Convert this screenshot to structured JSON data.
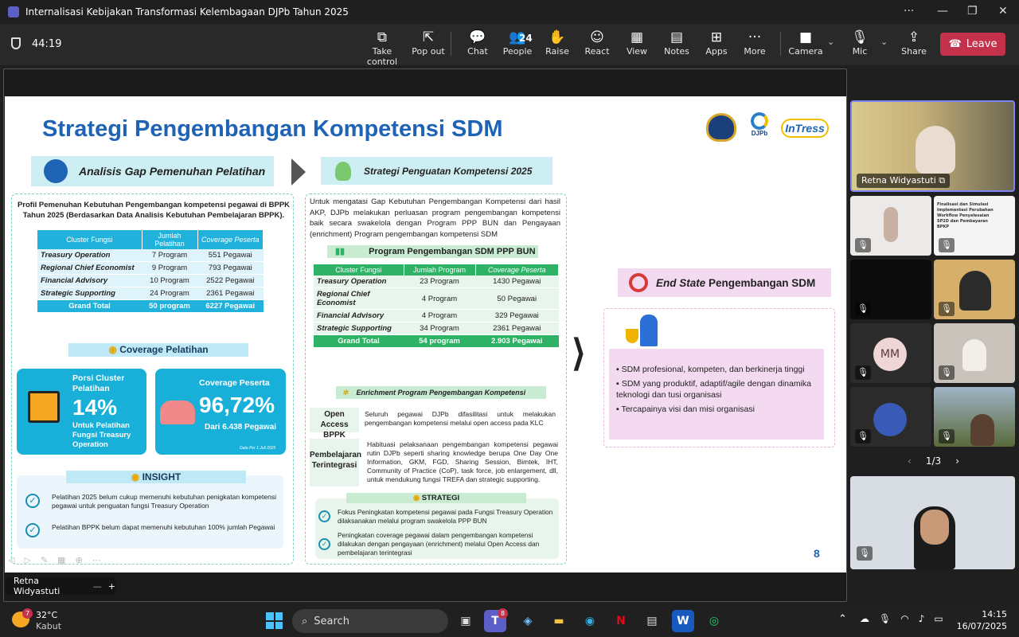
{
  "window": {
    "title": "Internalisasi Kebijakan Transformasi Kelembagaan DJPb Tahun 2025",
    "more": "···",
    "minimize": "—",
    "maximize": "❐",
    "close": "✕"
  },
  "meeting": {
    "timer": "44:19",
    "people_count": "24"
  },
  "toolbar": [
    {
      "label": "Take control",
      "icon": "⧉"
    },
    {
      "label": "Pop out",
      "icon": "⇱"
    },
    {
      "label": "Chat",
      "icon": "💬"
    },
    {
      "label": "People",
      "icon": "👥"
    },
    {
      "label": "Raise",
      "icon": "✋"
    },
    {
      "label": "React",
      "icon": "☺"
    },
    {
      "label": "View",
      "icon": "▦"
    },
    {
      "label": "Notes",
      "icon": "▤"
    },
    {
      "label": "Apps",
      "icon": "⊞"
    },
    {
      "label": "More",
      "icon": "···"
    },
    {
      "label": "Camera",
      "icon": "■"
    },
    {
      "label": "Mic",
      "icon": "🎙"
    },
    {
      "label": "Share",
      "icon": "⇪"
    }
  ],
  "leave_label": "Leave",
  "slide": {
    "title": "Strategi Pengembangan Kompetensi SDM",
    "logos": [
      "DJPb",
      "InTress"
    ],
    "left": {
      "header": "Analisis Gap Pemenuhan Pelatihan",
      "intro": "Profil Pemenuhan Kebutuhan Pengembangan kompetensi pegawai di BPPK Tahun 2025 (Berdasarkan Data Analisis Kebutuhan Pembelajaran BPPK).",
      "table": {
        "headers": [
          "Cluster Fungsi",
          "Jumlah Pelatihan",
          "Coverage Peserta"
        ],
        "rows": [
          [
            "Treasury Operation",
            "7 Program",
            "551 Pegawai"
          ],
          [
            "Regional Chief Economist",
            "9 Program",
            "793 Pegawai"
          ],
          [
            "Financial Advisory",
            "10 Program",
            "2522 Pegawai"
          ],
          [
            "Strategic Supporting",
            "24 Program",
            "2361 Pegawai"
          ]
        ],
        "total": [
          "Grand Total",
          "50 program",
          "6227 Pegawai"
        ]
      },
      "coverage_header": "Coverage Pelatihan",
      "card1": {
        "title": "Porsi Cluster Pelatihan",
        "value": "14%",
        "sub": "Untuk Pelatihan Fungsi Treasury Operation"
      },
      "card2": {
        "title": "Coverage Peserta",
        "value": "96,72%",
        "sub": "Dari 6.438 Pegawai",
        "note": "Data Per 1 Juli 2025"
      },
      "insight_header": "INSIGHT",
      "insights": [
        "Pelatihan 2025 belum cukup memenuhi kebutuhan penigkatan kompetensi pegawai untuk penguatan fungsi Treasury Operation",
        "Pelatihan BPPK belum dapat memenuhi kebutuhan 100% jumlah Pegawai"
      ]
    },
    "middle": {
      "header": "Strategi Penguatan Kompetensi 2025",
      "intro": "Untuk mengatasi Gap Kebutuhan Pengembangan Kompetensi dari hasil AKP, DJPb melakukan perluasan program pengembangan kompetensi baik secara swakelola dengan Program PPP BUN dan Pengayaan (enrichment) Program pengembangan kompetensi SDM",
      "ppp_header": "Program Pengembangan SDM PPP BUN",
      "table": {
        "headers": [
          "Cluster Fungsi",
          "Jumlah Program",
          "Coverage Peserta"
        ],
        "rows": [
          [
            "Treasury Operation",
            "23 Program",
            "1430 Pegawai"
          ],
          [
            "Regional Chief Economist",
            "4 Program",
            "50 Pegawai"
          ],
          [
            "Financial Advisory",
            "4 Program",
            "329 Pegawai"
          ],
          [
            "Strategic Supporting",
            "34 Program",
            "2361 Pegawai"
          ]
        ],
        "total": [
          "Grand Total",
          "54 program",
          "2.903 Pegawai"
        ]
      },
      "enrich_header": "Enrichment Program Pengembangan Kompetensi",
      "enrich": [
        {
          "label": "Open Access BPPK",
          "text": "Seluruh pegawai DJPb difasilitasi untuk melakukan pengembangan kompetensi melalui open access pada KLC"
        },
        {
          "label": "Pembelajaran Terintegrasi",
          "text": "Habituasi pelaksanaan pengembangan kompetensi pegawai rutin DJPb seperti sharing knowledge berupa One Day One Information, GKM, FGD, Sharing Session, Bimtek, IHT, Community of Practice (CoP), task force, job enlargement, dll, untuk mendukung fungsi TREFA dan strategic supporting."
        }
      ],
      "strategi_header": "STRATEGI",
      "strategi": [
        "Fokus Peningkatan kompetensi pegawai pada Fungsi Treasury Operation dilaksanakan melalui program swakelola PPP BUN",
        "Peningkatan coverage pegawai dalam pengembangan kompetensi dilakukan dengan pengayaan (enrichment) melalui Open Access dan pembelajaran terintegrasi"
      ]
    },
    "right": {
      "header_italic": "End State",
      "header_rest": "Pengembangan SDM",
      "bullets": [
        "SDM profesional, kompeten, dan berkinerja tinggi",
        "SDM yang produktif, adaptif/agile dengan dinamika teknologi dan tusi organisasi",
        "Tercapainya visi dan misi organisasi"
      ]
    },
    "page_number": "8"
  },
  "presenter_label": "Retna Widyastuti",
  "gallery": {
    "speaker": "Retna Widyastuti",
    "initials": "MM",
    "page": "1/3",
    "tile_text": "Finalisasi dan Simulasi Implementasi Perubahan Workflow Penyelesaian SP2D dan Pembayaran BPKP"
  },
  "taskbar": {
    "weather_temp": "32°C",
    "weather_desc": "Kabut",
    "weather_badge": "7",
    "search": "Search",
    "teams_badge": "8",
    "time": "14:15",
    "date": "16/07/2025"
  }
}
